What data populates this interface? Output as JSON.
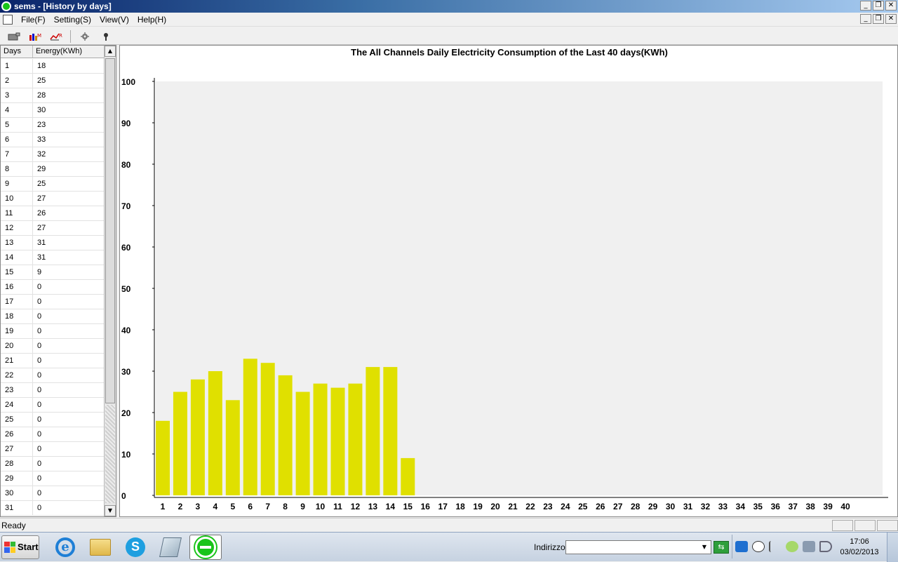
{
  "window": {
    "title": "sems - [History by days]"
  },
  "window_controls": {
    "minimize": "_",
    "restore": "❐",
    "close": "✕"
  },
  "menu": {
    "items": [
      "File(F)",
      "Setting(S)",
      "View(V)",
      "Help(H)"
    ]
  },
  "toolbar": {
    "icons": [
      "camera-icon",
      "daily-chart-icon",
      "history-chart-icon",
      "settings-gear-icon",
      "help-icon"
    ]
  },
  "table": {
    "columns": [
      "Days",
      "Energy(KWh)"
    ],
    "rows": [
      [
        "1",
        "18"
      ],
      [
        "2",
        "25"
      ],
      [
        "3",
        "28"
      ],
      [
        "4",
        "30"
      ],
      [
        "5",
        "23"
      ],
      [
        "6",
        "33"
      ],
      [
        "7",
        "32"
      ],
      [
        "8",
        "29"
      ],
      [
        "9",
        "25"
      ],
      [
        "10",
        "27"
      ],
      [
        "11",
        "26"
      ],
      [
        "12",
        "27"
      ],
      [
        "13",
        "31"
      ],
      [
        "14",
        "31"
      ],
      [
        "15",
        "9"
      ],
      [
        "16",
        "0"
      ],
      [
        "17",
        "0"
      ],
      [
        "18",
        "0"
      ],
      [
        "19",
        "0"
      ],
      [
        "20",
        "0"
      ],
      [
        "21",
        "0"
      ],
      [
        "22",
        "0"
      ],
      [
        "23",
        "0"
      ],
      [
        "24",
        "0"
      ],
      [
        "25",
        "0"
      ],
      [
        "26",
        "0"
      ],
      [
        "27",
        "0"
      ],
      [
        "28",
        "0"
      ],
      [
        "29",
        "0"
      ],
      [
        "30",
        "0"
      ],
      [
        "31",
        "0"
      ]
    ]
  },
  "chart_data": {
    "type": "bar",
    "title": "The All Channels Daily Electricity Consumption of the Last 40 days(KWh)",
    "categories": [
      "1",
      "2",
      "3",
      "4",
      "5",
      "6",
      "7",
      "8",
      "9",
      "10",
      "11",
      "12",
      "13",
      "14",
      "15",
      "16",
      "17",
      "18",
      "19",
      "20",
      "21",
      "22",
      "23",
      "24",
      "25",
      "26",
      "27",
      "28",
      "29",
      "30",
      "31",
      "32",
      "33",
      "34",
      "35",
      "36",
      "37",
      "38",
      "39",
      "40"
    ],
    "values": [
      18,
      25,
      28,
      30,
      23,
      33,
      32,
      29,
      25,
      27,
      26,
      27,
      31,
      31,
      9,
      0,
      0,
      0,
      0,
      0,
      0,
      0,
      0,
      0,
      0,
      0,
      0,
      0,
      0,
      0,
      0,
      0,
      0,
      0,
      0,
      0,
      0,
      0,
      0,
      0
    ],
    "ylim": [
      0,
      100
    ],
    "yticks": [
      0,
      10,
      20,
      30,
      40,
      50,
      60,
      70,
      80,
      90,
      100
    ],
    "xlabel": "",
    "ylabel": "",
    "bar_color": "#e0e000",
    "plot_background": "#f0f0f0",
    "grid": false
  },
  "status": {
    "text": "Ready"
  },
  "taskbar": {
    "start_label": "Start",
    "apps": [
      "internet-explorer-icon",
      "folder-icon",
      "skype-icon",
      "tablet-icon",
      "sems-icon"
    ],
    "address_label": "Indirizzo",
    "address_value": "",
    "time": "17:06",
    "date": "03/02/2013"
  }
}
